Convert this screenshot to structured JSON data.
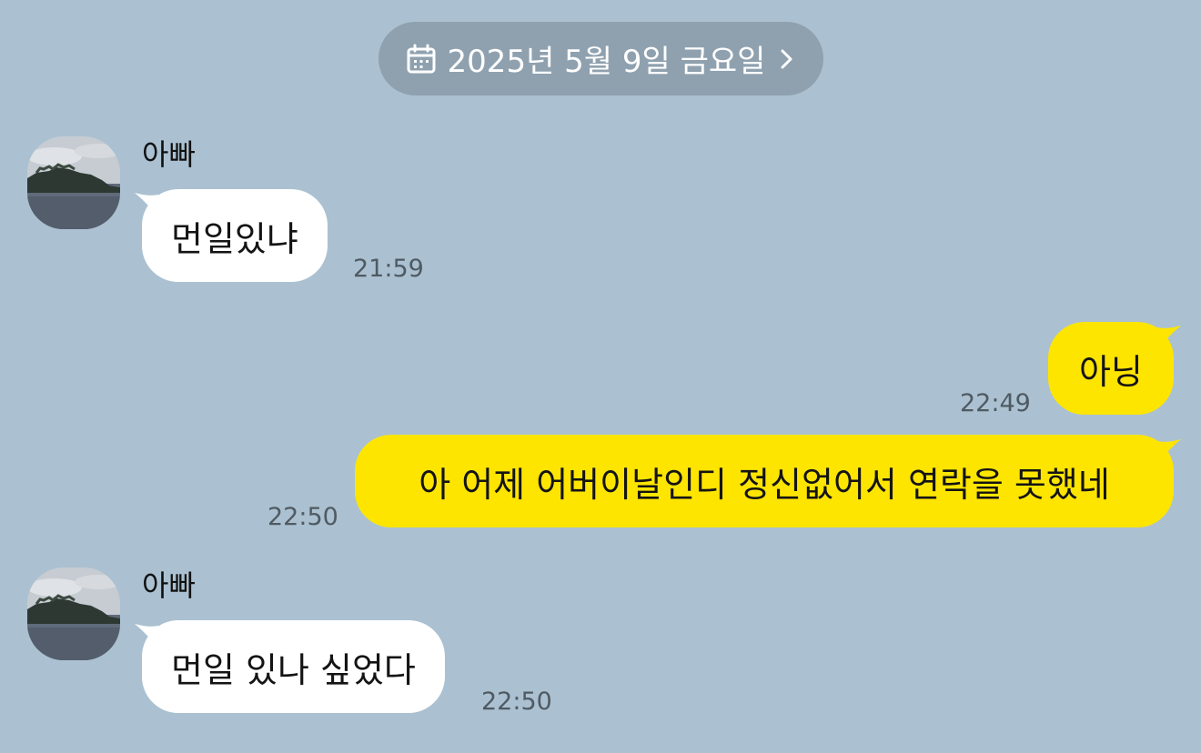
{
  "date_header": {
    "label": "2025년 5월 9일 금요일",
    "icon": "calendar-icon",
    "chevron": "chevron-right-icon"
  },
  "colors": {
    "background": "#abc1d1",
    "incoming_bubble": "#ffffff",
    "outgoing_bubble": "#fee500",
    "timestamp": "#4f5a63"
  },
  "messages": [
    {
      "sender": "아빠",
      "direction": "incoming",
      "text": "먼일있냐",
      "time": "21:59"
    },
    {
      "sender": "",
      "direction": "outgoing",
      "text": "아닝",
      "time": "22:49"
    },
    {
      "sender": "",
      "direction": "outgoing",
      "text": "아 어제 어버이날인디 정신없어서 연락을 못했네",
      "time": "22:50"
    },
    {
      "sender": "아빠",
      "direction": "incoming",
      "text": "먼일 있나 싶었다",
      "time": "22:50"
    }
  ]
}
